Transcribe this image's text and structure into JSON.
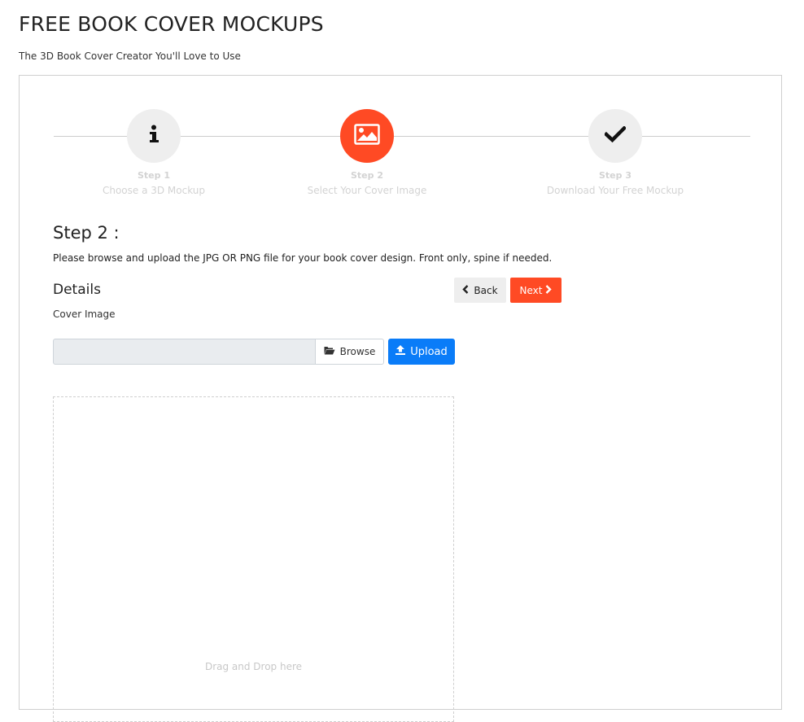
{
  "header": {
    "title": "FREE BOOK COVER MOCKUPS",
    "subtitle": "The 3D Book Cover Creator You'll Love to Use"
  },
  "wizard": {
    "steps": [
      {
        "number": "Step 1",
        "description": "Choose a 3D Mockup",
        "icon": "info-icon",
        "state": "inactive"
      },
      {
        "number": "Step 2",
        "description": "Select Your Cover Image",
        "icon": "image-icon",
        "state": "active"
      },
      {
        "number": "Step 3",
        "description": "Download Your Free Mockup",
        "icon": "checkmark-icon",
        "state": "inactive"
      }
    ],
    "accent_color": "#ff4a24",
    "inactive_color": "#eeeeee"
  },
  "content": {
    "step_heading": "Step 2 :",
    "instructions": "Please browse and upload the JPG OR PNG file for your book cover design. Front only, spine if needed.",
    "details_heading": "Details",
    "back_label": "Back",
    "next_label": "Next",
    "cover_label": "Cover Image",
    "file_value": "",
    "browse_label": "Browse",
    "upload_label": "Upload",
    "dropzone_text": "Drag and Drop here"
  },
  "colors": {
    "upload_button": "#0a7cf8",
    "next_button": "#ff4a24"
  }
}
